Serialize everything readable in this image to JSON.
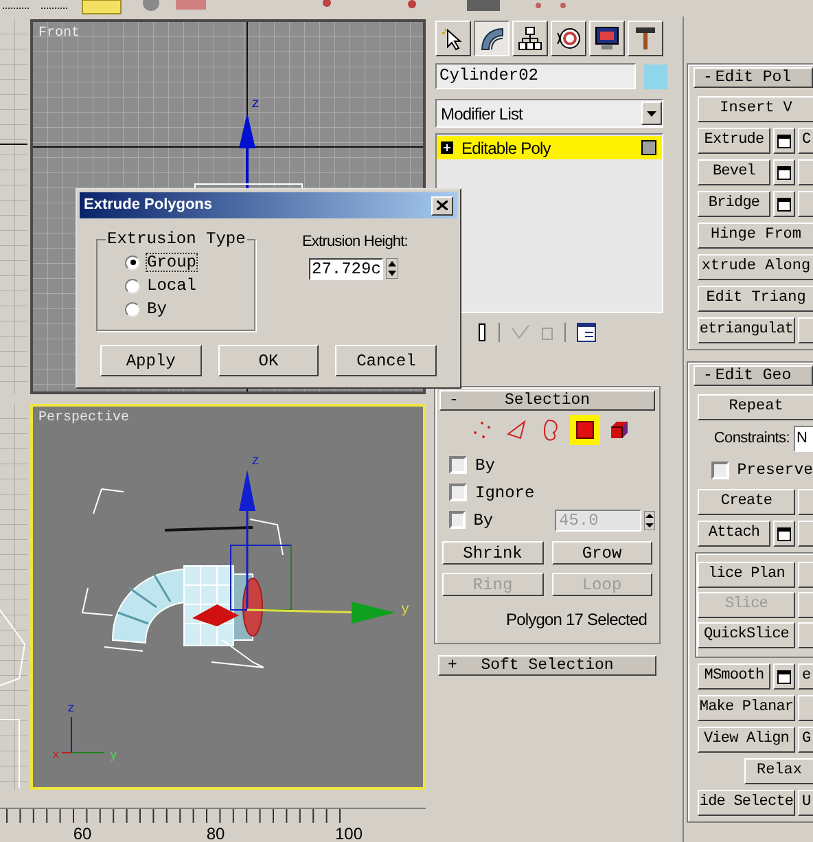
{
  "viewports": [
    {
      "kind": "grid",
      "label": "Front",
      "active": false,
      "axis_labels": [
        "z"
      ]
    },
    {
      "kind": "shaded",
      "label": "Perspective",
      "active": true,
      "axis_labels": [
        "z",
        "y"
      ],
      "tripod_labels": [
        "z",
        "x",
        "y"
      ]
    }
  ],
  "timeline": {
    "ticks": [
      "60",
      "80",
      "100"
    ]
  },
  "dialog": {
    "title": "Extrude Polygons",
    "group_title": "Extrusion Type",
    "options": [
      {
        "label": "Group",
        "selected": true
      },
      {
        "label": "Local",
        "selected": false
      },
      {
        "label": "By",
        "selected": false
      }
    ],
    "height_label": "Extrusion Height:",
    "height_value": "27.729c",
    "buttons": [
      "Apply",
      "OK",
      "Cancel"
    ]
  },
  "command_panel": {
    "tabs": [
      {
        "kind": "create",
        "selected": false
      },
      {
        "kind": "modify",
        "selected": true
      },
      {
        "kind": "hierarchy",
        "selected": false
      },
      {
        "kind": "motion",
        "selected": false
      },
      {
        "kind": "display",
        "selected": false
      },
      {
        "kind": "utilities",
        "selected": false
      }
    ],
    "object_name": "Cylinder02",
    "modifier_list": "Modifier List",
    "stack": [
      {
        "label": "Editable Poly",
        "selected": true
      }
    ],
    "selection": {
      "toggle": "-",
      "title": "Selection",
      "levels": [
        {
          "kind": "vertex",
          "selected": false
        },
        {
          "kind": "edge",
          "selected": false
        },
        {
          "kind": "border",
          "selected": false
        },
        {
          "kind": "polygon",
          "selected": true
        },
        {
          "kind": "element",
          "selected": false
        }
      ],
      "checkboxes": [
        {
          "label": "By",
          "checked": false
        },
        {
          "label": "Ignore",
          "checked": false
        },
        {
          "label": "By",
          "checked": false
        }
      ],
      "angle_value": "45.0",
      "buttons": [
        {
          "label": "Shrink",
          "disabled": false
        },
        {
          "label": "Grow",
          "disabled": false
        },
        {
          "label": "Ring",
          "disabled": true
        },
        {
          "label": "Loop",
          "disabled": true
        }
      ],
      "status": "Polygon 17 Selected"
    },
    "soft_selection": {
      "toggle": "+",
      "title": "Soft Selection"
    }
  },
  "edit_panel": {
    "rollouts": [
      {
        "toggle": "-",
        "title": "Edit Pol",
        "rows": [
          {
            "kind": "wide",
            "label": "Insert V"
          },
          {
            "kind": "pair",
            "label": "Extrude",
            "settings": true,
            "second": "C"
          },
          {
            "kind": "pair",
            "label": "Bevel",
            "settings": true
          },
          {
            "kind": "pair",
            "label": "Bridge",
            "settings": true
          },
          {
            "kind": "wide",
            "label": "Hinge From"
          },
          {
            "kind": "wide",
            "label": "xtrude Along"
          },
          {
            "kind": "wide",
            "label": "Edit Triang"
          },
          {
            "kind": "pair",
            "label": "etriangulat",
            "settings": false
          }
        ]
      },
      {
        "toggle": "-",
        "title": "Edit Geo",
        "rows": [
          {
            "kind": "wide",
            "label": "Repeat"
          },
          {
            "kind": "field",
            "label": "Constraints:",
            "value": "N"
          },
          {
            "kind": "checkbox",
            "label": "Preserve",
            "checked": false
          },
          {
            "kind": "pair",
            "label": "Create",
            "settings": false
          },
          {
            "kind": "pair",
            "label": "Attach",
            "settings": true
          },
          {
            "kind": "group",
            "rows": [
              {
                "kind": "pair",
                "label": "lice Plan",
                "settings": false
              },
              {
                "kind": "pair",
                "label": "Slice",
                "settings": false,
                "disabled": true
              },
              {
                "kind": "pair",
                "label": "QuickSlice",
                "settings": false
              }
            ]
          },
          {
            "kind": "pair",
            "label": "MSmooth",
            "settings": true,
            "second": "e"
          },
          {
            "kind": "pair",
            "label": "Make Planar",
            "settings": false
          },
          {
            "kind": "pair",
            "label": "View Align",
            "settings": false,
            "second": "G"
          },
          {
            "kind": "center",
            "label": "Relax"
          },
          {
            "kind": "pair",
            "label": "ide Selecte",
            "settings": false,
            "second": "U"
          }
        ]
      }
    ]
  }
}
